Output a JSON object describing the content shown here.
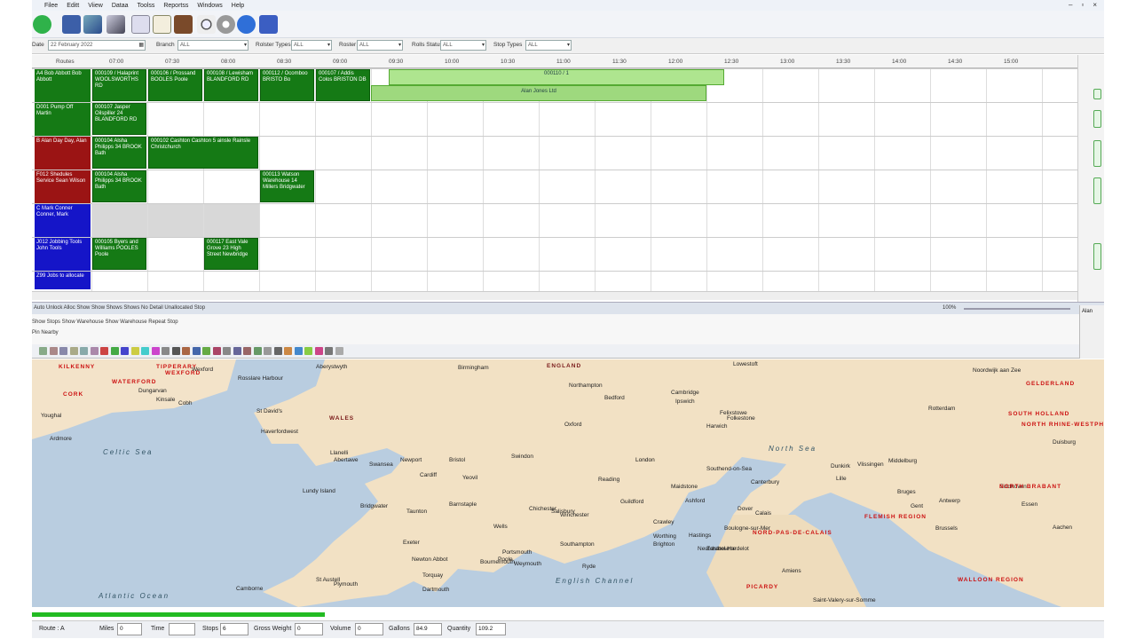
{
  "menu": [
    "Filee",
    "Editt",
    "Viiew",
    "Dataa",
    "Toolss",
    "Reportss",
    "Windows",
    "Help"
  ],
  "filters": [
    {
      "label": "Date",
      "value": "22 February 2022"
    },
    {
      "label": "Branch",
      "value": "ALL"
    },
    {
      "label": "Rolster Types",
      "value": "ALL"
    },
    {
      "label": "Roster",
      "value": "ALL"
    },
    {
      "label": "Rolls Status",
      "value": "ALL"
    },
    {
      "label": "Stop Types",
      "value": "ALL"
    }
  ],
  "schedule": {
    "corner": "Routes",
    "times": [
      "07:00",
      "07:30",
      "08:00",
      "08:30",
      "09:00",
      "09:30",
      "10:00",
      "10:30",
      "11:00",
      "11:30",
      "12:00",
      "12:30",
      "13:00",
      "13:30",
      "14:00",
      "14:30",
      "15:00"
    ],
    "resources": [
      {
        "text": "A4  Bob Abbott  Bob Abbott",
        "color": "#157a15"
      },
      {
        "text": "D001  Pump Off  Martin",
        "color": "#157a15"
      },
      {
        "text": "B  Alan Day  Day, Alan",
        "color": "#9b1414"
      },
      {
        "text": "F012  Shedules Service  Sean Wilson",
        "color": "#9b1414"
      },
      {
        "text": "C  Mark Conner  Conner, Mark",
        "color": "#1515c8"
      },
      {
        "text": "J012  Jobbing Tools  John Tools",
        "color": "#1515c8"
      },
      {
        "text": "Z99  Jobs to allocate",
        "color": "#1515c8"
      }
    ],
    "jobs": [
      {
        "text": "000109 / Halaprint  WOOLSWORTHS  RD",
        "row": 0,
        "col": 0
      },
      {
        "text": "000106 / Prossand  BOOLES  Poole",
        "row": 0,
        "col": 1
      },
      {
        "text": "000108 / Lewisham  BLANDFORD  RD",
        "row": 0,
        "col": 2
      },
      {
        "text": "000112 / Ocomboo  BRISTO  Bo",
        "row": 0,
        "col": 3
      },
      {
        "text": "000107 / Addis Colos  BRISTON  DB",
        "row": 0,
        "col": 4
      },
      {
        "text": "000107  Jasper Oilspiller  24 BLANDFORD  RD",
        "row": 1,
        "col": 0
      },
      {
        "text": "000104  Alsha Philipps  34 BROOK  Bath",
        "row": 2,
        "col": 0
      },
      {
        "text": "000102  Cashton Cashton  5 ainsle Rainsle  Christchurch",
        "row": 2,
        "col": 1
      },
      {
        "text": "000104  Alsha Philipps  34 BROOK  Bath",
        "row": 3,
        "col": 0
      },
      {
        "text": "000113  Watson Warehouse  14 Millers  Bridgwater",
        "row": 3,
        "col": 3
      },
      {
        "text": "000105  Byers and Williams  POOLES  Poole",
        "row": 5,
        "col": 0
      },
      {
        "text": "000117  East Vale Grove  23 High Street  Newbridge",
        "row": 5,
        "col": 2
      }
    ],
    "long_bar": {
      "label": "000110 / 1",
      "sub": "Alan Jones Ltd"
    }
  },
  "strip": {
    "text": "Auto Unlock  Alloc  Show  Show Shows Shows  No  Detail  Unallocated  Stop",
    "zoom": "100%"
  },
  "strip2": {
    "line1": "Show Stops  Show Warehouse  Show Warehouse  Repeat Stop",
    "line2": "Pin Nearby"
  },
  "right_panel_label": "Alan",
  "map": {
    "sea_labels": [
      "Celtic Sea",
      "Atlantic Ocean",
      "North Sea",
      "English Channel"
    ],
    "places": [
      {
        "name": "Birmingham",
        "c": "#222"
      },
      {
        "name": "ENGLAND",
        "c": "#7a1a1a"
      },
      {
        "name": "Lowestoft",
        "c": "#222"
      },
      {
        "name": "Cardiff",
        "c": "#222"
      },
      {
        "name": "WALES",
        "c": "#7a1a1a"
      },
      {
        "name": "Bristol",
        "c": "#222"
      },
      {
        "name": "Swindon",
        "c": "#222"
      },
      {
        "name": "Oxford",
        "c": "#222"
      },
      {
        "name": "London",
        "c": "#111"
      },
      {
        "name": "Southend-on-Sea",
        "c": "#222"
      },
      {
        "name": "Canterbury",
        "c": "#222"
      },
      {
        "name": "Dover",
        "c": "#222"
      },
      {
        "name": "Calais",
        "c": "#222"
      },
      {
        "name": "Ipswich",
        "c": "#222"
      },
      {
        "name": "Felixstowe",
        "c": "#222"
      },
      {
        "name": "Harwich",
        "c": "#222"
      },
      {
        "name": "Cambridge",
        "c": "#222"
      },
      {
        "name": "Bedford",
        "c": "#222"
      },
      {
        "name": "Northampton",
        "c": "#222"
      },
      {
        "name": "Swansea",
        "c": "#222"
      },
      {
        "name": "Newport",
        "c": "#222"
      },
      {
        "name": "Exeter",
        "c": "#222"
      },
      {
        "name": "Plymouth",
        "c": "#222"
      },
      {
        "name": "Torquay",
        "c": "#222"
      },
      {
        "name": "Newton Abbot",
        "c": "#222"
      },
      {
        "name": "Taunton",
        "c": "#222"
      },
      {
        "name": "Bridgwater",
        "c": "#222"
      },
      {
        "name": "Barnstaple",
        "c": "#222"
      },
      {
        "name": "Yeovil",
        "c": "#222"
      },
      {
        "name": "Salisbury",
        "c": "#222"
      },
      {
        "name": "Southampton",
        "c": "#222"
      },
      {
        "name": "Portsmouth",
        "c": "#222"
      },
      {
        "name": "Bournemouth",
        "c": "#222"
      },
      {
        "name": "Poole",
        "c": "#222"
      },
      {
        "name": "Weymouth",
        "c": "#222"
      },
      {
        "name": "Winchester",
        "c": "#222"
      },
      {
        "name": "Reading",
        "c": "#222"
      },
      {
        "name": "Guildford",
        "c": "#222"
      },
      {
        "name": "Brighton",
        "c": "#222"
      },
      {
        "name": "Crawley",
        "c": "#222"
      },
      {
        "name": "Maidstone",
        "c": "#222"
      },
      {
        "name": "Ashford",
        "c": "#222"
      },
      {
        "name": "Hastings",
        "c": "#222"
      },
      {
        "name": "Folkestone",
        "c": "#222"
      },
      {
        "name": "Boulogne-sur-Mer",
        "c": "#222"
      },
      {
        "name": "NORD-PAS-DE-CALAIS",
        "c": "#c11"
      },
      {
        "name": "PICARDY",
        "c": "#c11"
      },
      {
        "name": "Amiens",
        "c": "#222"
      },
      {
        "name": "Lille",
        "c": "#222"
      },
      {
        "name": "Dunkirk",
        "c": "#222"
      },
      {
        "name": "Bruges",
        "c": "#222"
      },
      {
        "name": "Gent",
        "c": "#222"
      },
      {
        "name": "Antwerp",
        "c": "#222"
      },
      {
        "name": "Brussels",
        "c": "#222"
      },
      {
        "name": "FLEMISH REGION",
        "c": "#c11"
      },
      {
        "name": "WALLOON REGION",
        "c": "#c11"
      },
      {
        "name": "Rotterdam",
        "c": "#222"
      },
      {
        "name": "Eindhoven",
        "c": "#222"
      },
      {
        "name": "Vlissingen",
        "c": "#222"
      },
      {
        "name": "Middelburg",
        "c": "#222"
      },
      {
        "name": "Noordwijk aan Zee",
        "c": "#222"
      },
      {
        "name": "NORTH BRABANT",
        "c": "#c11"
      },
      {
        "name": "SOUTH HOLLAND",
        "c": "#c11"
      },
      {
        "name": "NORTH RHINE-WESTPHALIA",
        "c": "#c11"
      },
      {
        "name": "GELDERLAND",
        "c": "#c11"
      },
      {
        "name": "Duisburg",
        "c": "#222"
      },
      {
        "name": "Essen",
        "c": "#222"
      },
      {
        "name": "Aachen",
        "c": "#222"
      },
      {
        "name": "Lundy Island",
        "c": "#222"
      },
      {
        "name": "Abertawe",
        "c": "#222"
      },
      {
        "name": "Llanelli",
        "c": "#222"
      },
      {
        "name": "Haverfordwest",
        "c": "#222"
      },
      {
        "name": "St David's",
        "c": "#222"
      },
      {
        "name": "Aberystwyth",
        "c": "#222"
      },
      {
        "name": "WATERFORD",
        "c": "#c11"
      },
      {
        "name": "WEXFORD",
        "c": "#c11"
      },
      {
        "name": "TIPPERARY",
        "c": "#c11"
      },
      {
        "name": "KILKENNY",
        "c": "#c11"
      },
      {
        "name": "CORK",
        "c": "#c11"
      },
      {
        "name": "Wexford",
        "c": "#222"
      },
      {
        "name": "Rosslare Harbour",
        "c": "#222"
      },
      {
        "name": "Dungarvan",
        "c": "#222"
      },
      {
        "name": "Youghal",
        "c": "#222"
      },
      {
        "name": "Cobh",
        "c": "#222"
      },
      {
        "name": "Kinsale",
        "c": "#222"
      },
      {
        "name": "Ardmore",
        "c": "#222"
      },
      {
        "name": "Saint-Valery-sur-Somme",
        "c": "#222"
      },
      {
        "name": "Neufchatel-Hardelot",
        "c": "#222"
      },
      {
        "name": "Camborne",
        "c": "#222"
      },
      {
        "name": "St Austell",
        "c": "#222"
      },
      {
        "name": "Dartmouth",
        "c": "#222"
      },
      {
        "name": "Ryde",
        "c": "#222"
      },
      {
        "name": "Worthing",
        "c": "#222"
      },
      {
        "name": "Eastbourne",
        "c": "#222"
      },
      {
        "name": "Wells",
        "c": "#222"
      },
      {
        "name": "Chichester",
        "c": "#222"
      }
    ]
  },
  "bottom": {
    "fields": [
      {
        "label": "Route :",
        "value": "A"
      },
      {
        "label": "Miles",
        "value": "0"
      },
      {
        "label": "Time",
        "value": ""
      },
      {
        "label": "Stops",
        "value": "6"
      },
      {
        "label": "Gross Weight",
        "value": "0"
      },
      {
        "label": "Volume",
        "value": "0"
      },
      {
        "label": "Gallons",
        "value": "84.9"
      },
      {
        "label": "Quantity",
        "value": "109.2"
      }
    ]
  }
}
